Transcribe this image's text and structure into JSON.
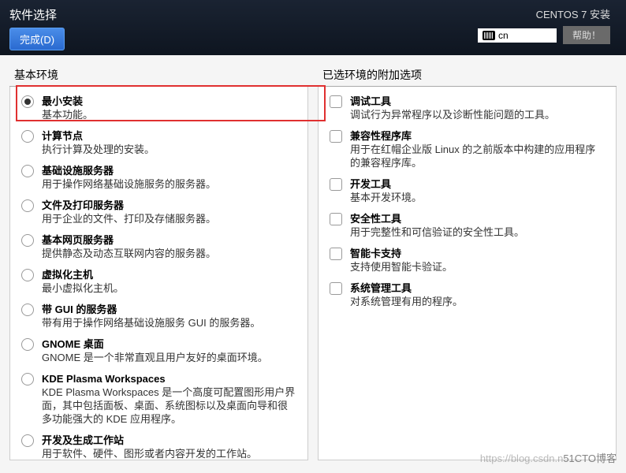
{
  "header": {
    "page_title": "软件选择",
    "done_label": "完成(D)",
    "install_title": "CENTOS 7 安装",
    "lang_code": "cn",
    "help_label": "帮助！"
  },
  "left": {
    "heading": "基本环境",
    "items": [
      {
        "title": "最小安装",
        "desc": "基本功能。",
        "selected": true
      },
      {
        "title": "计算节点",
        "desc": "执行计算及处理的安装。",
        "selected": false
      },
      {
        "title": "基础设施服务器",
        "desc": "用于操作网络基础设施服务的服务器。",
        "selected": false
      },
      {
        "title": "文件及打印服务器",
        "desc": "用于企业的文件、打印及存储服务器。",
        "selected": false
      },
      {
        "title": "基本网页服务器",
        "desc": "提供静态及动态互联网内容的服务器。",
        "selected": false
      },
      {
        "title": "虚拟化主机",
        "desc": "最小虚拟化主机。",
        "selected": false
      },
      {
        "title": "带 GUI 的服务器",
        "desc": "带有用于操作网络基础设施服务 GUI 的服务器。",
        "selected": false
      },
      {
        "title": "GNOME 桌面",
        "desc": "GNOME 是一个非常直观且用户友好的桌面环境。",
        "selected": false
      },
      {
        "title": "KDE Plasma Workspaces",
        "desc": "KDE Plasma Workspaces 是一个高度可配置图形用户界面，其中包括面板、桌面、系统图标以及桌面向导和很多功能强大的 KDE 应用程序。",
        "selected": false
      },
      {
        "title": "开发及生成工作站",
        "desc": "用于软件、硬件、图形或者内容开发的工作站。",
        "selected": false
      }
    ]
  },
  "right": {
    "heading": "已选环境的附加选项",
    "items": [
      {
        "title": "调试工具",
        "desc": "调试行为异常程序以及诊断性能问题的工具。"
      },
      {
        "title": "兼容性程序库",
        "desc": "用于在红帽企业版 Linux 的之前版本中构建的应用程序的兼容程序库。"
      },
      {
        "title": "开发工具",
        "desc": "基本开发环境。"
      },
      {
        "title": "安全性工具",
        "desc": "用于完整性和可信验证的安全性工具。"
      },
      {
        "title": "智能卡支持",
        "desc": "支持使用智能卡验证。"
      },
      {
        "title": "系统管理工具",
        "desc": "对系统管理有用的程序。"
      }
    ]
  },
  "watermark": {
    "left": "https://blog.csdn.n",
    "right": "51CTO博客"
  }
}
